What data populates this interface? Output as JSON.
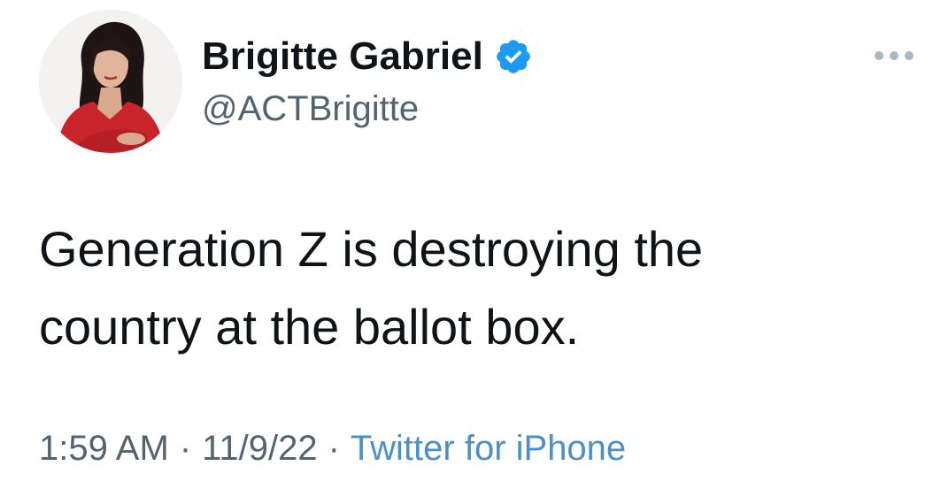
{
  "author": {
    "display_name": "Brigitte Gabriel",
    "handle": "@ACTBrigitte",
    "verified": true,
    "avatar_icon": "profile-photo"
  },
  "tweet": {
    "text_lines": [
      "Generation Z is destroying the",
      "country at the ballot box."
    ]
  },
  "meta": {
    "time": "1:59 AM",
    "separator": "·",
    "date": "11/9/22",
    "source": "Twitter for iPhone"
  },
  "colors": {
    "name": "#0f1419",
    "secondary": "#536471",
    "link": "#4a90c9",
    "verified": "#1d9bf0"
  },
  "icons": {
    "verified": "verified-badge-icon",
    "more": "more-options-icon"
  }
}
